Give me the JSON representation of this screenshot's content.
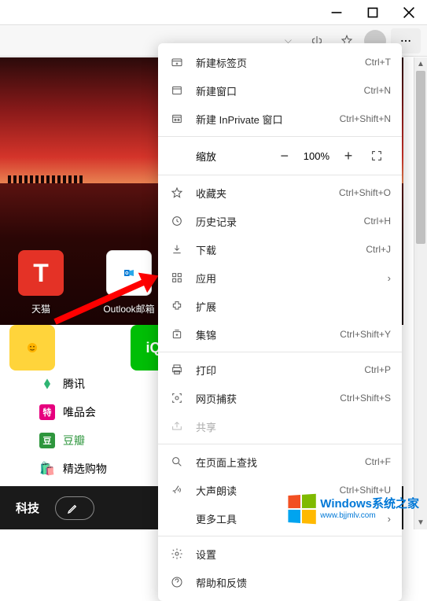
{
  "window": {
    "minimize": "—",
    "maximize": "▢",
    "close": "✕"
  },
  "menu": {
    "new_tab": {
      "label": "新建标签页",
      "shortcut": "Ctrl+T"
    },
    "new_window": {
      "label": "新建窗口",
      "shortcut": "Ctrl+N"
    },
    "new_inprivate": {
      "label": "新建 InPrivate 窗口",
      "shortcut": "Ctrl+Shift+N"
    },
    "zoom": {
      "label": "缩放",
      "value": "100%"
    },
    "favorites": {
      "label": "收藏夹",
      "shortcut": "Ctrl+Shift+O"
    },
    "history": {
      "label": "历史记录",
      "shortcut": "Ctrl+H"
    },
    "downloads": {
      "label": "下载",
      "shortcut": "Ctrl+J"
    },
    "apps": {
      "label": "应用"
    },
    "extensions": {
      "label": "扩展"
    },
    "collections": {
      "label": "集锦",
      "shortcut": "Ctrl+Shift+Y"
    },
    "print": {
      "label": "打印",
      "shortcut": "Ctrl+P"
    },
    "capture": {
      "label": "网页捕获",
      "shortcut": "Ctrl+Shift+S"
    },
    "share": {
      "label": "共享"
    },
    "find": {
      "label": "在页面上查找",
      "shortcut": "Ctrl+F"
    },
    "read_aloud": {
      "label": "大声朗读",
      "shortcut": "Ctrl+Shift+U"
    },
    "more_tools": {
      "label": "更多工具"
    },
    "settings": {
      "label": "设置"
    },
    "help": {
      "label": "帮助和反馈"
    }
  },
  "tiles": {
    "tmall": {
      "label": "天猫",
      "glyph": "T",
      "bg": "#e43226"
    },
    "outlook": {
      "label": "Outlook邮箱",
      "glyph": "O",
      "bg": "#0078d4"
    }
  },
  "tiles2": {
    "yellow": {
      "bg": "#ffd43b"
    },
    "iqiyi": {
      "bg": "#00be06",
      "glyph": "iQ"
    }
  },
  "links": {
    "tencent": {
      "label": "腾讯",
      "badge_bg": "#2fb573"
    },
    "vip": {
      "label": "唯品会",
      "badge": "特",
      "badge_bg": "#e6007e"
    },
    "douban": {
      "label": "豆瓣",
      "badge": "豆",
      "badge_bg": "#2e963d",
      "color": "#2e963d"
    },
    "shopping": {
      "label": "精选购物",
      "badge": "🛍️"
    }
  },
  "bottom": {
    "tab": "科技",
    "edit": ""
  },
  "watermark": {
    "main": "Windows系统之家",
    "sub": "www.bjjmlv.com"
  }
}
